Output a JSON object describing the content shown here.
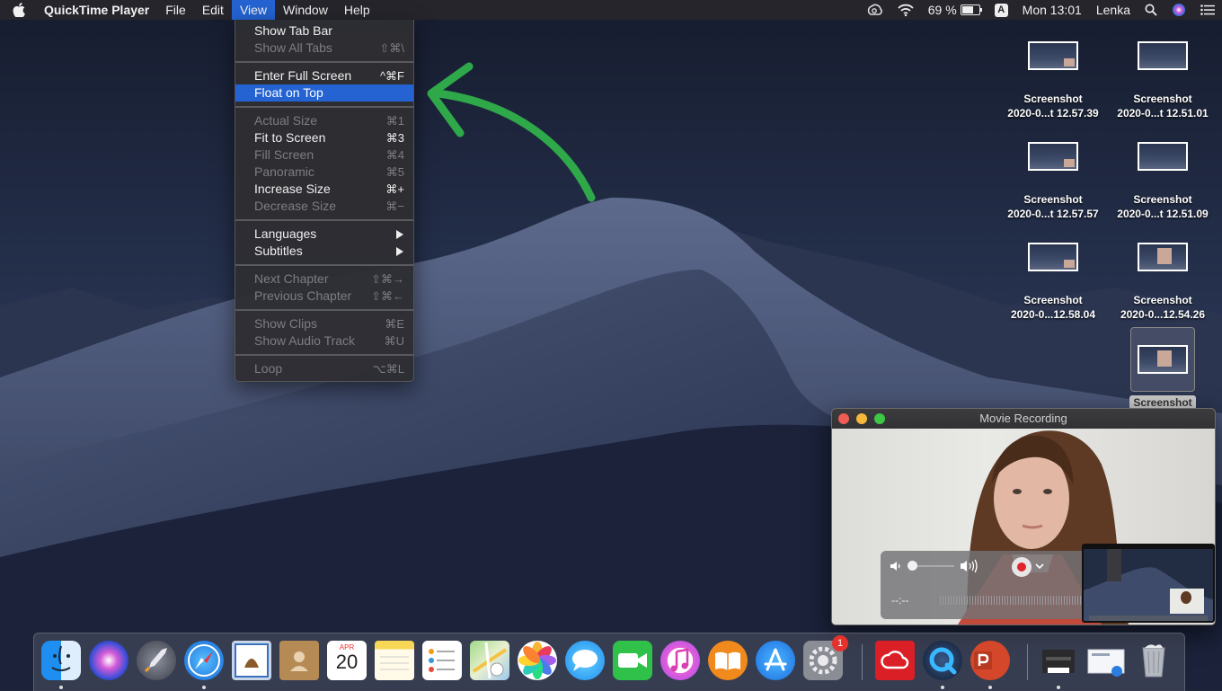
{
  "menubar": {
    "apple_icon": "apple-icon",
    "app_name": "QuickTime Player",
    "items": [
      "File",
      "Edit",
      "View",
      "Window",
      "Help"
    ],
    "active_item": "View",
    "battery_percent": "69 %",
    "battery_level": 0.69,
    "input_source": "A",
    "clock": "Mon 13:01",
    "user": "Lenka"
  },
  "view_menu": {
    "items": [
      {
        "label": "Show Tab Bar",
        "shortcut": "",
        "enabled": true
      },
      {
        "label": "Show All Tabs",
        "shortcut": "⇧⌘\\",
        "enabled": false
      },
      {
        "label": "Enter Full Screen",
        "shortcut": "^⌘F",
        "enabled": true
      },
      {
        "label": "Float on Top",
        "shortcut": "",
        "enabled": true,
        "highlighted": true
      },
      {
        "label": "Actual Size",
        "shortcut": "⌘1",
        "enabled": false
      },
      {
        "label": "Fit to Screen",
        "shortcut": "⌘3",
        "enabled": true
      },
      {
        "label": "Fill Screen",
        "shortcut": "⌘4",
        "enabled": false
      },
      {
        "label": "Panoramic",
        "shortcut": "⌘5",
        "enabled": false
      },
      {
        "label": "Increase Size",
        "shortcut": "⌘+",
        "enabled": true
      },
      {
        "label": "Decrease Size",
        "shortcut": "⌘−",
        "enabled": false
      },
      {
        "label": "Languages",
        "shortcut": "",
        "enabled": true,
        "submenu": true
      },
      {
        "label": "Subtitles",
        "shortcut": "",
        "enabled": true,
        "submenu": true
      },
      {
        "label": "Next Chapter",
        "shortcut": "⇧⌘→",
        "enabled": false
      },
      {
        "label": "Previous Chapter",
        "shortcut": "⇧⌘←",
        "enabled": false
      },
      {
        "label": "Show Clips",
        "shortcut": "⌘E",
        "enabled": false
      },
      {
        "label": "Show Audio Track",
        "shortcut": "⌘U",
        "enabled": false
      },
      {
        "label": "Loop",
        "shortcut": "⌥⌘L",
        "enabled": false
      }
    ]
  },
  "desktop_icons": [
    {
      "name": "Screenshot",
      "sub": "2020-0...t 12.57.39",
      "selected": false
    },
    {
      "name": "Screenshot",
      "sub": "2020-0...t 12.51.01",
      "selected": false
    },
    {
      "name": "Screenshot",
      "sub": "2020-0...t 12.57.57",
      "selected": false
    },
    {
      "name": "Screenshot",
      "sub": "2020-0...t 12.51.09",
      "selected": false
    },
    {
      "name": "Screenshot",
      "sub": "2020-0...12.58.04",
      "selected": false
    },
    {
      "name": "Screenshot",
      "sub": "2020-0...12.54.26",
      "selected": false
    },
    {
      "name": "Screenshot",
      "sub": "",
      "selected": true
    }
  ],
  "movie_window": {
    "title": "Movie Recording",
    "time": "--:--"
  },
  "dock": {
    "apps": [
      {
        "name": "finder-icon",
        "running": true
      },
      {
        "name": "siri-icon",
        "running": false
      },
      {
        "name": "launchpad-icon",
        "running": false
      },
      {
        "name": "safari-icon",
        "running": true
      },
      {
        "name": "mail-icon",
        "running": false
      },
      {
        "name": "contacts-icon",
        "running": false
      },
      {
        "name": "calendar-icon",
        "running": false
      },
      {
        "name": "notes-icon",
        "running": false
      },
      {
        "name": "reminders-icon",
        "running": false
      },
      {
        "name": "maps-icon",
        "running": false
      },
      {
        "name": "photos-icon",
        "running": false
      },
      {
        "name": "messages-icon",
        "running": false
      },
      {
        "name": "facetime-icon",
        "running": false
      },
      {
        "name": "itunes-icon",
        "running": false
      },
      {
        "name": "books-icon",
        "running": false
      },
      {
        "name": "app-store-icon",
        "running": false
      },
      {
        "name": "system-preferences-icon",
        "running": false
      },
      {
        "name": "creative-cloud-icon",
        "running": false
      },
      {
        "name": "quicktime-icon",
        "running": true
      },
      {
        "name": "powerpoint-icon",
        "running": true
      },
      {
        "name": "printer-icon",
        "running": true
      },
      {
        "name": "preview-folder-icon",
        "running": false
      },
      {
        "name": "trash-icon",
        "running": false
      }
    ],
    "calendar_month": "APR",
    "calendar_day": "20",
    "system_prefs_badge": "1"
  },
  "colors": {
    "menu_highlight": "#2463d1",
    "annotation_arrow": "#2fa84a",
    "record_red": "#e0262c"
  }
}
